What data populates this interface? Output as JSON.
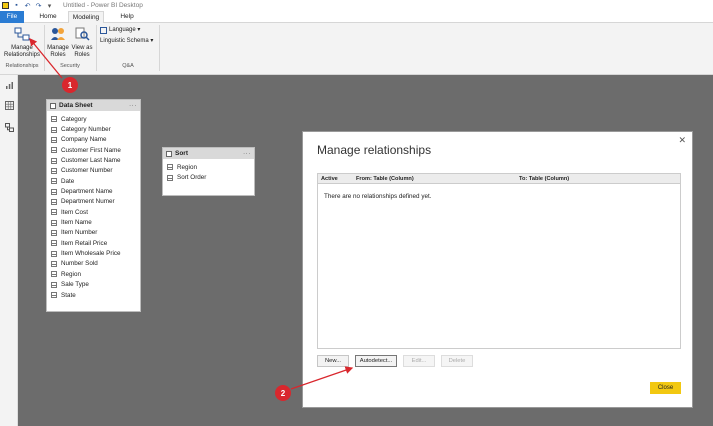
{
  "window": {
    "title": "Untitled - Power BI Desktop"
  },
  "tabs": [
    {
      "label": "File"
    },
    {
      "label": "Home"
    },
    {
      "label": "Modeling"
    },
    {
      "label": "Help"
    }
  ],
  "ribbon": {
    "manage_relationships": {
      "line1": "Manage",
      "line2": "Relationships"
    },
    "manage_roles": {
      "line1": "Manage",
      "line2": "Roles"
    },
    "view_as_roles": {
      "line1": "View as",
      "line2": "Roles"
    },
    "language": "Language ▾",
    "linguistic_schema": "Linguistic Schema ▾",
    "groups": {
      "relationships": "Relationships",
      "security": "Security",
      "qa": "Q&A"
    }
  },
  "tables": {
    "data_sheet": {
      "name": "Data Sheet",
      "fields": [
        "Category",
        "Category Number",
        "Company Name",
        "Customer First Name",
        "Customer Last Name",
        "Customer Number",
        "Date",
        "Department Name",
        "Department Numer",
        "Item Cost",
        "Item Name",
        "Item Number",
        "Item Retail Price",
        "Item Wholesale Price",
        "Number Sold",
        "Region",
        "Sale Type",
        "State"
      ]
    },
    "sort": {
      "name": "Sort",
      "fields": [
        "Region",
        "Sort Order"
      ]
    }
  },
  "dialog": {
    "title": "Manage relationships",
    "columns": {
      "active": "Active",
      "from": "From: Table (Column)",
      "to": "To: Table (Column)"
    },
    "empty_message": "There are no relationships defined yet.",
    "buttons": {
      "new": "New...",
      "autodetect": "Autodetect...",
      "edit": "Edit...",
      "delete": "Delete",
      "close": "Close"
    }
  },
  "callouts": {
    "one": "1",
    "two": "2"
  },
  "colors": {
    "accent_yellow": "#f2c811",
    "file_tab": "#2b7cd3",
    "callout_red": "#d9272d",
    "canvas": "#6c6c6c"
  }
}
